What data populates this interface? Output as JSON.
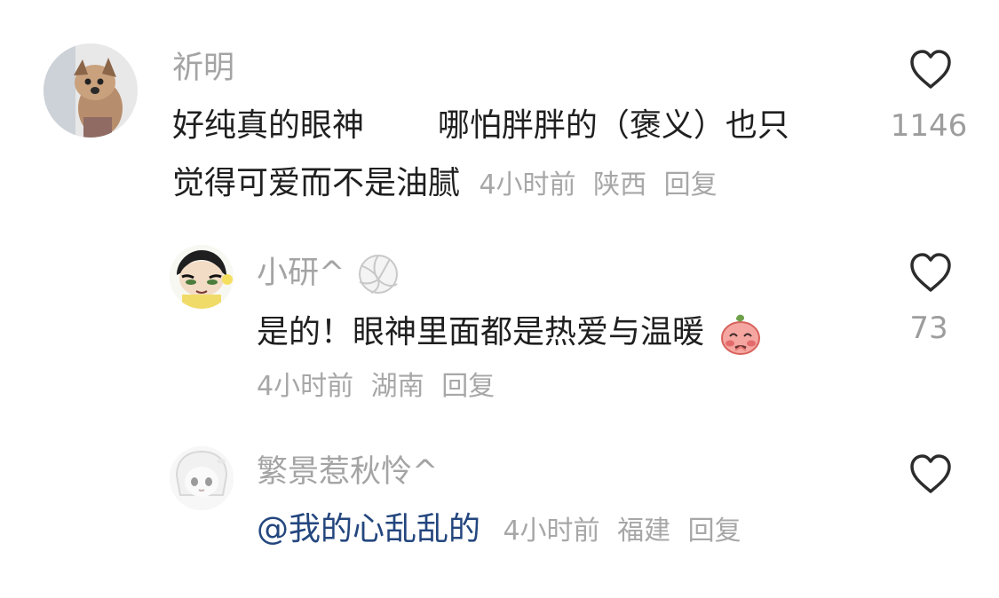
{
  "comments": [
    {
      "username": "祈明",
      "text_line1_part1": "好纯真的眼神",
      "text_line1_part2": "哪怕胖胖的（褒义）也只",
      "text_line2": "觉得可爱而不是油腻",
      "time": "4小时前",
      "location": "陕西",
      "reply_label": "回复",
      "likes": "1146",
      "avatar_icon": "dog-avatar-icon"
    },
    {
      "username": "小研^",
      "text": "是的！眼神里面都是热爱与温暖",
      "time": "4小时前",
      "location": "湖南",
      "reply_label": "回复",
      "likes": "73",
      "avatar_icon": "cartoon-boy-avatar-icon",
      "username_emoji": "volleyball-icon",
      "text_emoji": "blushing-peach-emoji-icon"
    },
    {
      "username": "繁景惹秋怜^",
      "mention": "@我的心乱乱的",
      "time": "4小时前",
      "location": "福建",
      "reply_label": "回复",
      "avatar_icon": "anime-girl-avatar-icon"
    }
  ],
  "colors": {
    "username": "#a4a4a4",
    "text": "#1f1f1f",
    "meta": "#a7a7a7",
    "mention": "#23467e",
    "like_icon": "#2c2c2c",
    "like_count": "#9d9d9d"
  }
}
